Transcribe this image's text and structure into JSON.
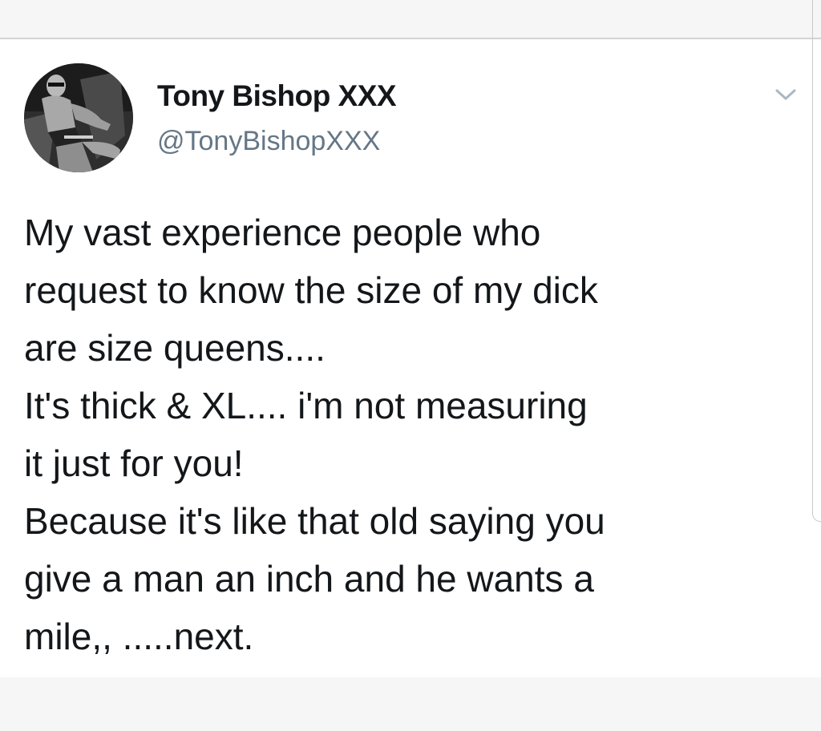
{
  "tweet": {
    "author_name": "Tony Bishop XXX",
    "author_handle": "@TonyBishopXXX",
    "text": "My vast experience people who\nrequest to know the size of my dick\nare size queens....\nIt's thick & XL.... i'm not measuring\nit just for you!\nBecause it's like that old saying you\ngive a man an inch and he wants a\nmile,, .....next."
  },
  "icons": {
    "menu": "chevron-down-icon",
    "avatar": "profile-photo"
  },
  "colors": {
    "text_primary": "#14171a",
    "text_secondary": "#657786",
    "background": "#ffffff",
    "strip": "#f6f6f6"
  }
}
